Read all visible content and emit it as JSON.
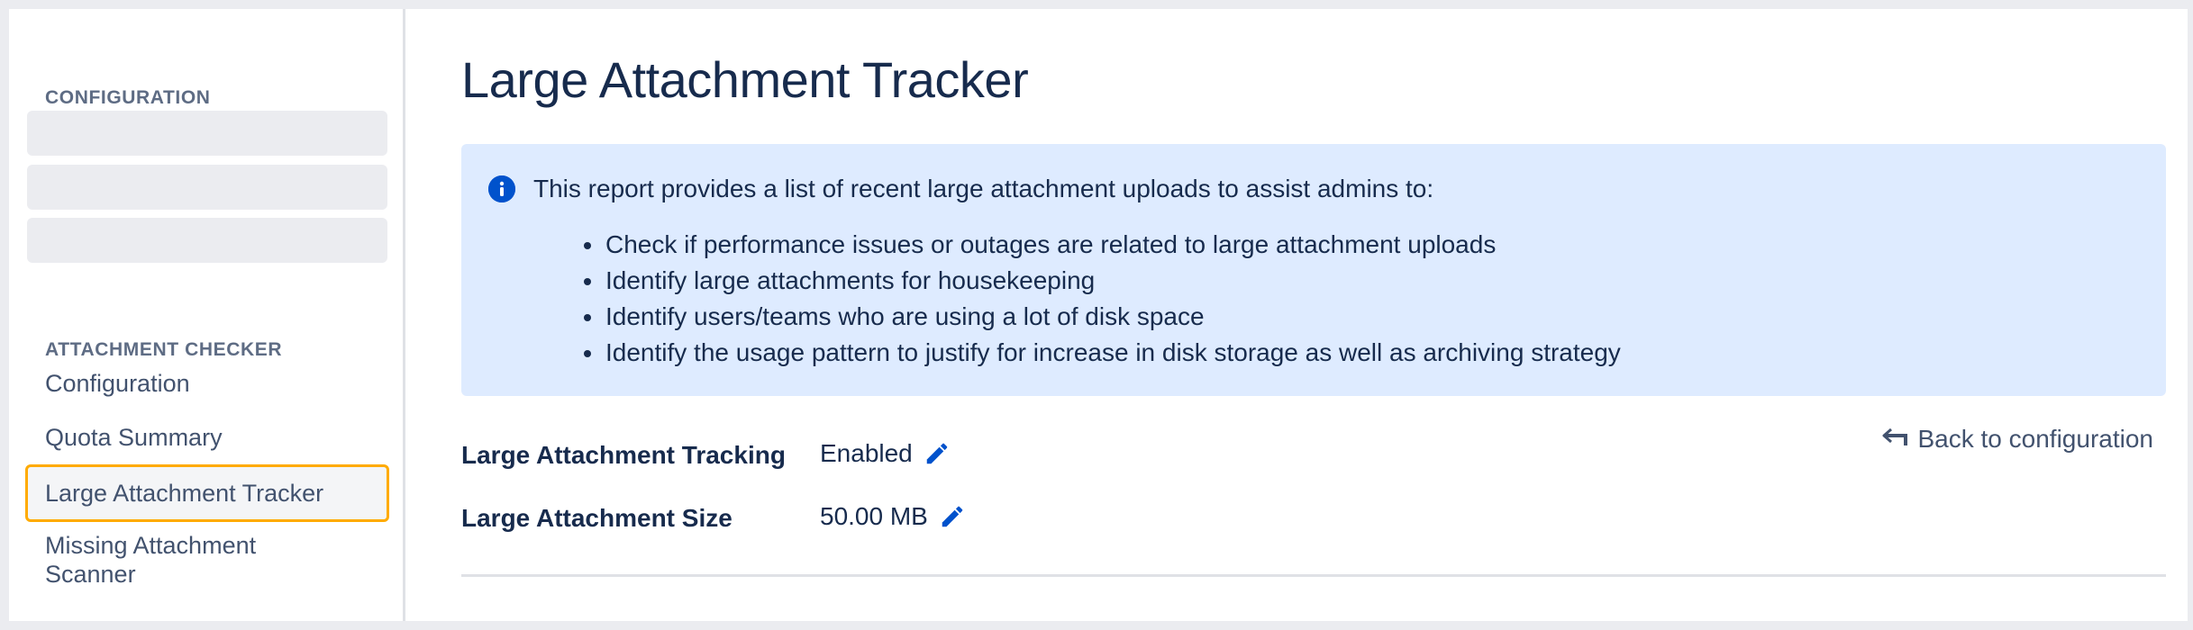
{
  "sidebar": {
    "configuration_heading": "CONFIGURATION",
    "attachment_checker_heading": "ATTACHMENT CHECKER",
    "items": [
      {
        "label": "Configuration"
      },
      {
        "label": "Quota Summary"
      },
      {
        "label": "Large Attachment Tracker",
        "selected": true
      },
      {
        "label": "Missing Attachment Scanner"
      }
    ]
  },
  "main": {
    "title": "Large Attachment Tracker",
    "info": {
      "intro": "This report provides a list of recent large attachment uploads to assist admins to:",
      "bullets": [
        "Check if performance issues or outages are related to large attachment uploads",
        "Identify large attachments for housekeeping",
        "Identify users/teams who are using a lot of disk space",
        "Identify the usage pattern to justify for increase in disk storage as well as archiving strategy"
      ]
    },
    "settings": {
      "tracking_label": "Large Attachment Tracking",
      "tracking_value": "Enabled",
      "size_label": "Large Attachment Size",
      "size_value": "50.00 MB"
    },
    "back_link": "Back to configuration"
  },
  "icons": {
    "info": "info-icon",
    "edit": "pencil-icon",
    "back": "back-arrow-icon"
  },
  "colors": {
    "accent": "#0052cc",
    "selected_border": "#ffab00",
    "info_bg": "#deebff"
  }
}
